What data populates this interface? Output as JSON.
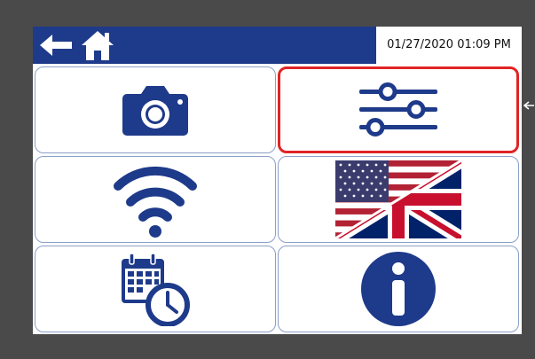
{
  "datetime": "01/27/2020 01:09 PM",
  "colors": {
    "bar": "#1e3a8a",
    "icon": "#1e3a8a",
    "selection": "#e02424",
    "frame": "#4a4a4a"
  },
  "tiles": [
    {
      "name": "camera",
      "icon": "camera-icon"
    },
    {
      "name": "settings",
      "icon": "sliders-icon",
      "selected": true
    },
    {
      "name": "wifi",
      "icon": "wifi-icon"
    },
    {
      "name": "language",
      "icon": "us-uk-flag-icon"
    },
    {
      "name": "schedule",
      "icon": "calendar-clock-icon"
    },
    {
      "name": "info",
      "icon": "info-icon"
    }
  ]
}
